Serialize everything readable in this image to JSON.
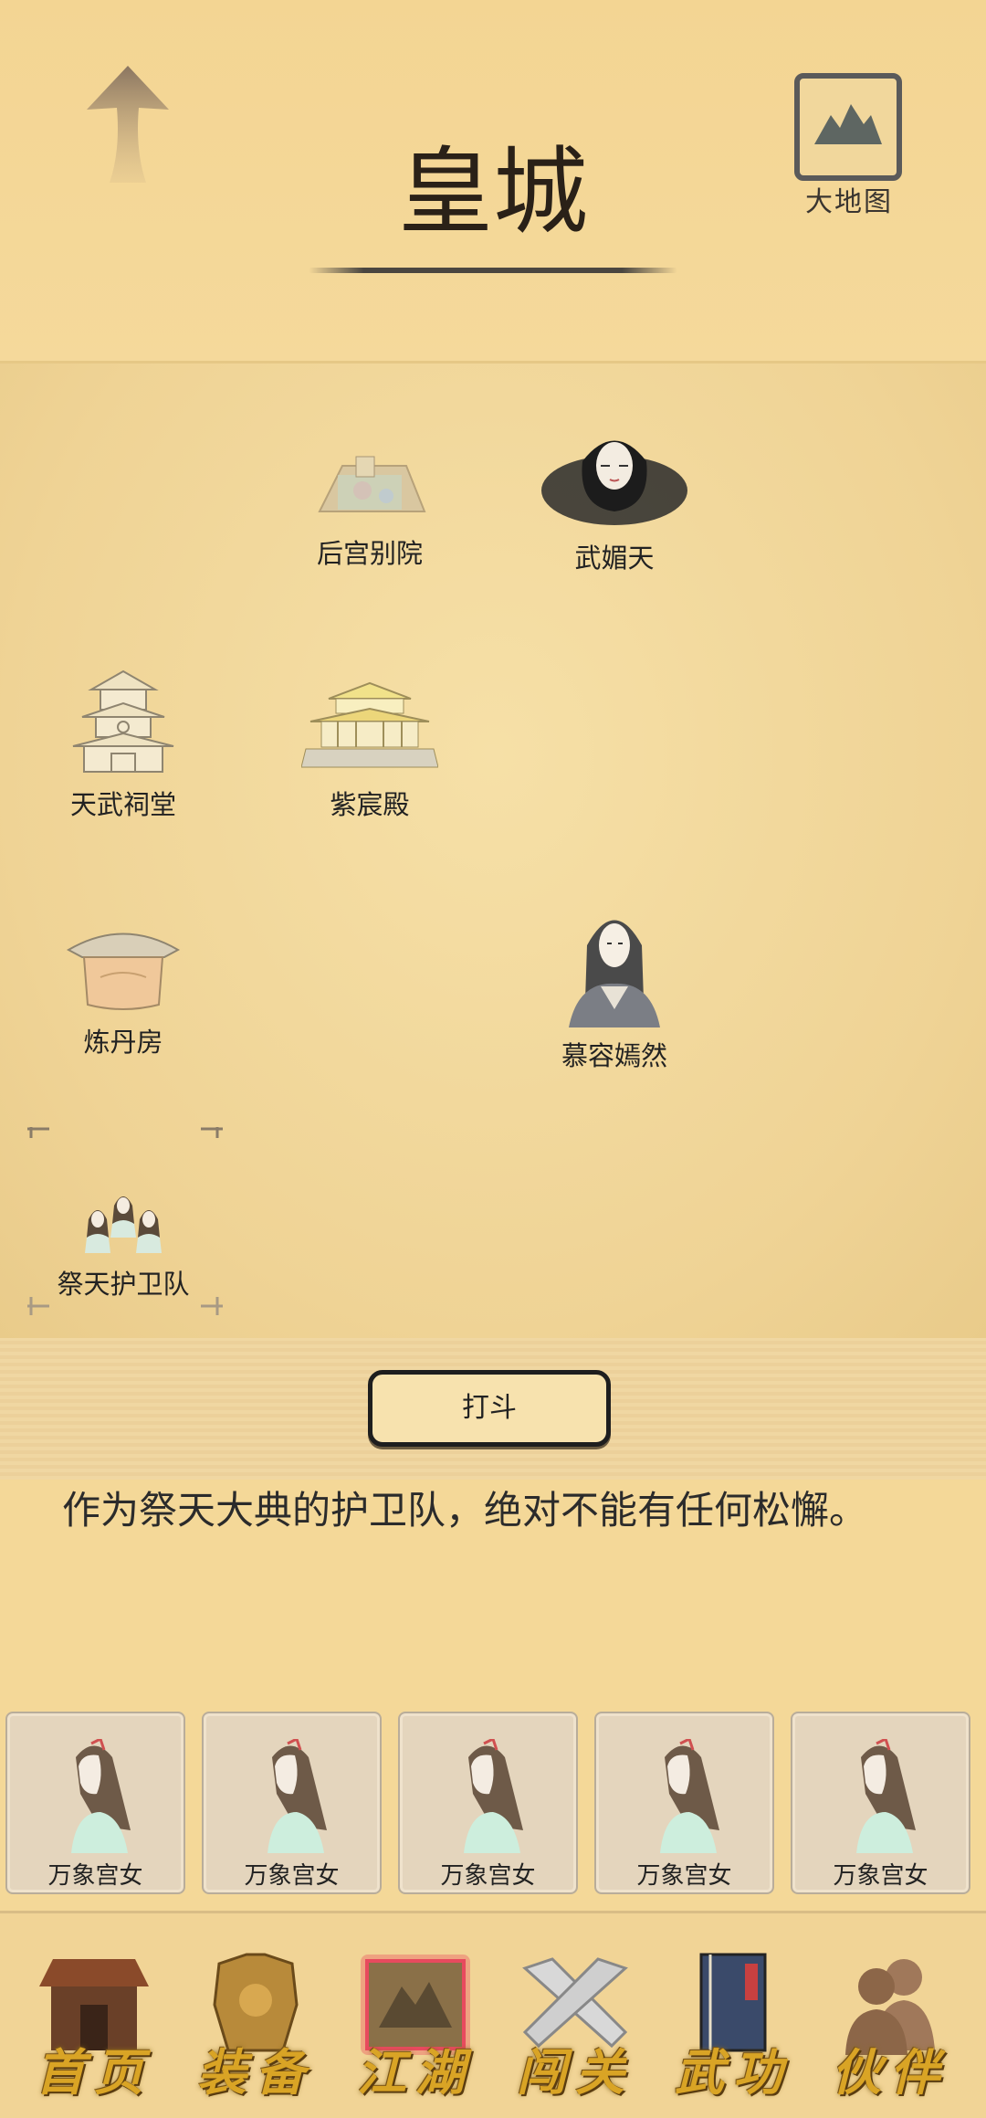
{
  "header": {
    "title": "皇城",
    "map_label": "大地图",
    "back_icon": "up-arrow-icon",
    "map_icon": "mountain-icon"
  },
  "scene": {
    "nodes": [
      {
        "label": "后宫别院",
        "icon": "palace-ruins-icon"
      },
      {
        "label": "武媚天",
        "icon": "woman-portrait-icon"
      },
      {
        "label": "天武祠堂",
        "icon": "pagoda-icon"
      },
      {
        "label": "紫宸殿",
        "icon": "palace-hall-icon"
      },
      {
        "label": "炼丹房",
        "icon": "alchemy-house-icon"
      },
      {
        "label": "慕容嫣然",
        "icon": "woman-portrait-icon"
      },
      {
        "label": "祭天护卫队",
        "icon": "guard-group-icon"
      }
    ]
  },
  "action": {
    "fight_label": "打斗"
  },
  "description": "作为祭天大典的护卫队，绝对不能有任何松懈。",
  "cards": [
    {
      "label": "万象宫女"
    },
    {
      "label": "万象宫女"
    },
    {
      "label": "万象宫女"
    },
    {
      "label": "万象宫女"
    },
    {
      "label": "万象宫女"
    }
  ],
  "nav": [
    {
      "label": "首页",
      "icon": "house-icon"
    },
    {
      "label": "装备",
      "icon": "armor-icon"
    },
    {
      "label": "江湖",
      "icon": "scroll-map-icon",
      "active": true
    },
    {
      "label": "闯关",
      "icon": "crossed-swords-icon"
    },
    {
      "label": "武功",
      "icon": "book-icon"
    },
    {
      "label": "伙伴",
      "icon": "people-icon"
    }
  ],
  "colors": {
    "background": "#f4d898",
    "nav_text": "#d9a425",
    "active_glow": "#e8455a"
  }
}
